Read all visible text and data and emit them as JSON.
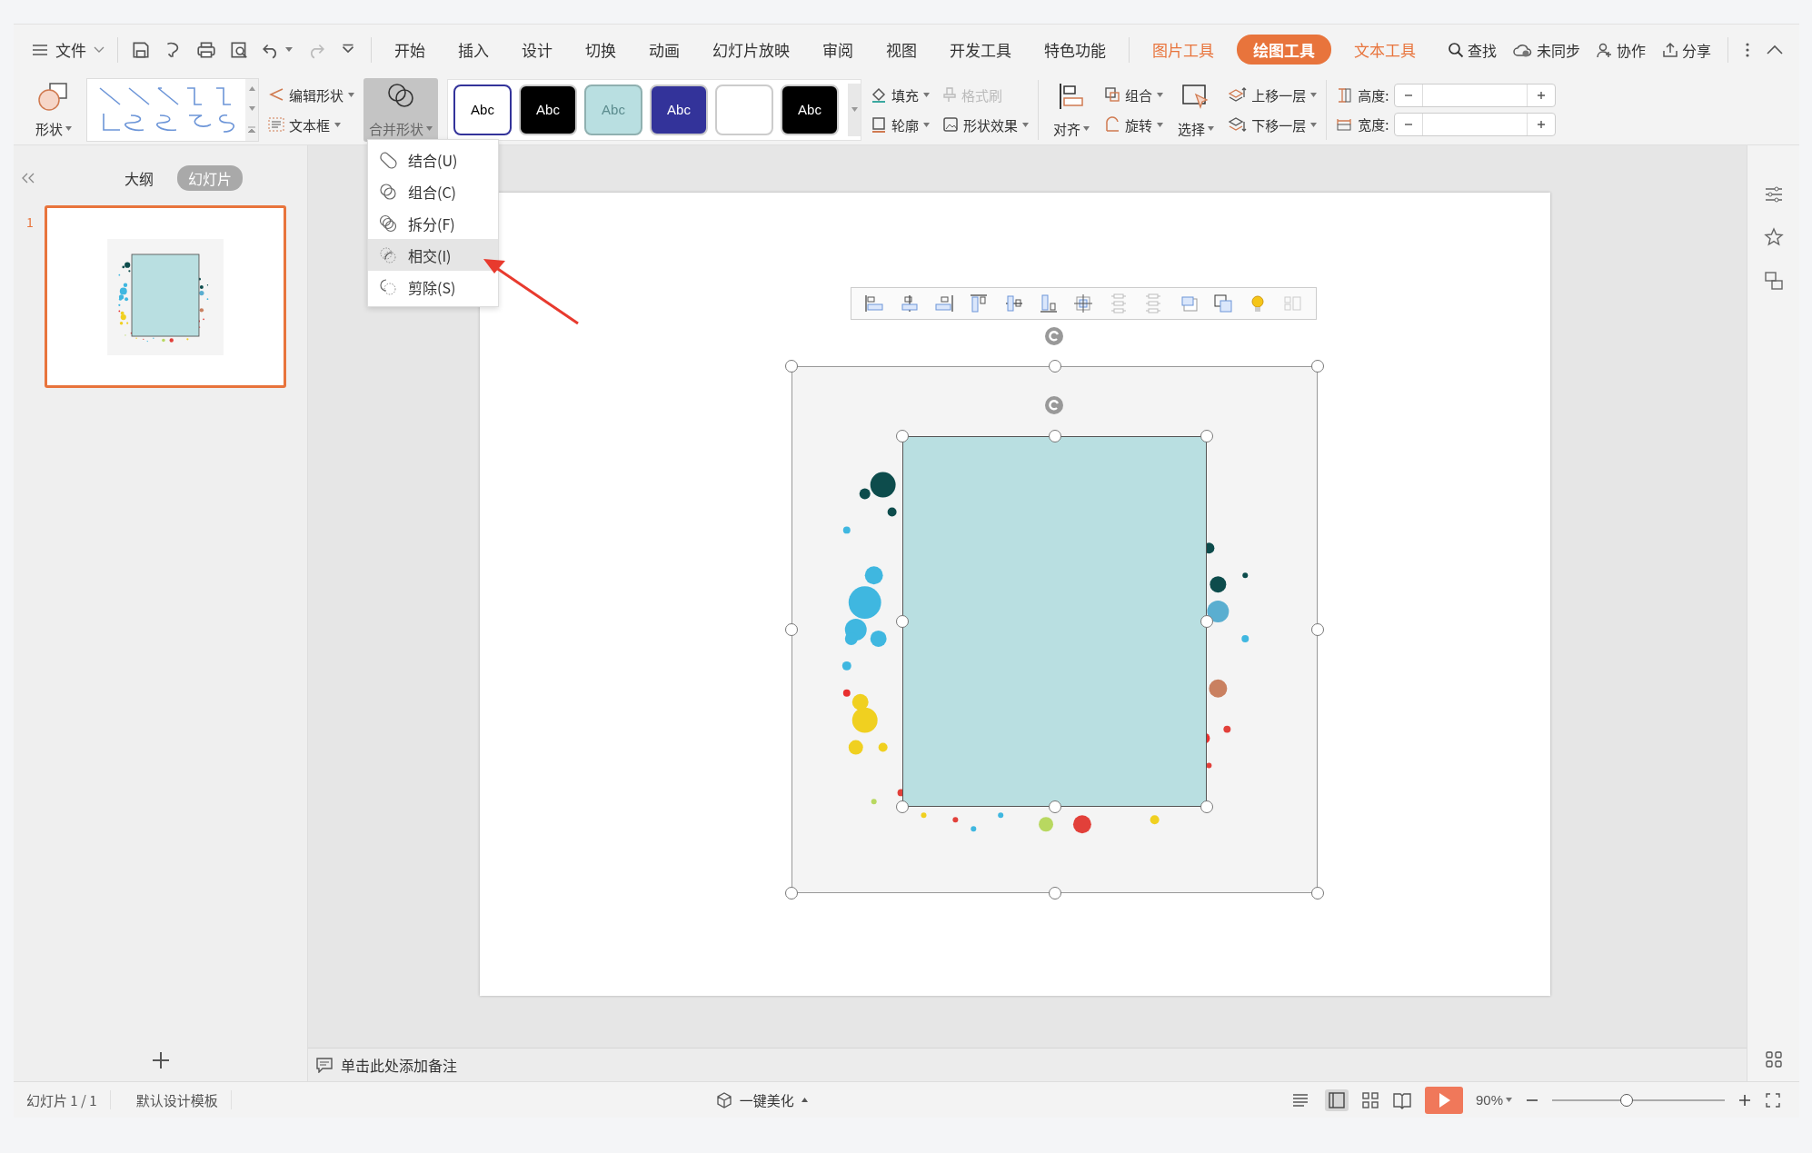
{
  "file_menu": {
    "label": "文件"
  },
  "menu_tabs": [
    {
      "label": "开始",
      "kind": "plain",
      "selected": false
    },
    {
      "label": "插入",
      "kind": "plain",
      "selected": false
    },
    {
      "label": "设计",
      "kind": "plain",
      "selected": false
    },
    {
      "label": "切换",
      "kind": "plain",
      "selected": false
    },
    {
      "label": "动画",
      "kind": "plain",
      "selected": false
    },
    {
      "label": "幻灯片放映",
      "kind": "plain",
      "selected": false
    },
    {
      "label": "审阅",
      "kind": "plain",
      "selected": false
    },
    {
      "label": "视图",
      "kind": "plain",
      "selected": false
    },
    {
      "label": "开发工具",
      "kind": "plain",
      "selected": false
    },
    {
      "label": "特色功能",
      "kind": "plain",
      "selected": false
    },
    {
      "label": "图片工具",
      "kind": "tool",
      "selected": false
    },
    {
      "label": "绘图工具",
      "kind": "tool",
      "selected": true
    },
    {
      "label": "文本工具",
      "kind": "tool",
      "selected": false
    }
  ],
  "top_actions": {
    "search": "查找",
    "sync": "未同步",
    "collaborate": "协作",
    "share": "分享"
  },
  "ribbon": {
    "shape": "形状",
    "edit_shape": "编辑形状",
    "text_box": "文本框",
    "merge_shape": {
      "label": "合并形状",
      "expanded": true
    },
    "style_swatches": [
      {
        "label": "Abc",
        "color": "#ffffff"
      },
      {
        "label": "Abc",
        "color": "#000000"
      },
      {
        "label": "Abc",
        "color": "#b9dfe1"
      },
      {
        "label": "Abc",
        "color": "#33339a"
      },
      {
        "color": "#ffffff"
      },
      {
        "label": "Abc",
        "color": "#000000"
      }
    ],
    "fill": "填充",
    "format_painter": {
      "label": "格式刷",
      "disabled": true
    },
    "outline": "轮廓",
    "shape_effect": "形状效果",
    "align": "对齐",
    "group": "组合",
    "rotate": "旋转",
    "select": "选择",
    "bring_forward": "上移一层",
    "send_backward": "下移一层",
    "height_label": "高度:",
    "width_label": "宽度:"
  },
  "merge_menu": [
    {
      "label": "结合(U)",
      "selected": false
    },
    {
      "label": "组合(C)",
      "selected": false
    },
    {
      "label": "拆分(F)",
      "selected": false
    },
    {
      "label": "相交(I)",
      "selected": true
    },
    {
      "label": "剪除(S)",
      "selected": false
    }
  ],
  "side_panel": {
    "tabs": [
      {
        "label": "大纲",
        "selected": false
      },
      {
        "label": "幻灯片",
        "selected": true
      }
    ],
    "slides": [
      {
        "number": "1",
        "selected": true
      }
    ]
  },
  "notes": {
    "placeholder": "单击此处添加备注"
  },
  "status_bar": {
    "slide_counter": "幻灯片 1 / 1",
    "template": "默认设计模板",
    "beautify": "一键美化",
    "zoom": {
      "reading": "90%",
      "level": 0.43
    }
  }
}
